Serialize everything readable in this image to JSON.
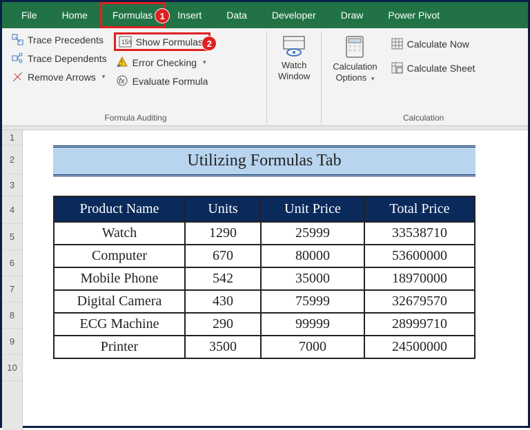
{
  "tabs": {
    "file": "File",
    "home": "Home",
    "formulas": "Formulas",
    "insert": "Insert",
    "data": "Data",
    "developer": "Developer",
    "draw": "Draw",
    "powerpivot": "Power Pivot"
  },
  "callouts": {
    "one": "1",
    "two": "2"
  },
  "ribbon": {
    "trace_precedents": "Trace Precedents",
    "trace_dependents": "Trace Dependents",
    "remove_arrows": "Remove Arrows",
    "show_formulas": "Show Formulas",
    "error_checking": "Error Checking",
    "evaluate_formula": "Evaluate Formula",
    "watch_window": "Watch Window",
    "calculation_options": "Calculation Options",
    "calculate_now": "Calculate Now",
    "calculate_sheet": "Calculate Sheet",
    "group_auditing": "Formula Auditing",
    "group_calculation": "Calculation"
  },
  "rows": {
    "r1": "1",
    "r2": "2",
    "r3": "3",
    "r4": "4",
    "r5": "5",
    "r6": "6",
    "r7": "7",
    "r8": "8",
    "r9": "9",
    "r10": "10"
  },
  "title": "Utilizing Formulas Tab",
  "table": {
    "headers": {
      "product": "Product Name",
      "units": "Units",
      "unitprice": "Unit Price",
      "total": "Total Price"
    },
    "rows": [
      {
        "product": "Watch",
        "units": "1290",
        "unitprice": "25999",
        "total": "33538710"
      },
      {
        "product": "Computer",
        "units": "670",
        "unitprice": "80000",
        "total": "53600000"
      },
      {
        "product": "Mobile Phone",
        "units": "542",
        "unitprice": "35000",
        "total": "18970000"
      },
      {
        "product": "Digital Camera",
        "units": "430",
        "unitprice": "75999",
        "total": "32679570"
      },
      {
        "product": "ECG Machine",
        "units": "290",
        "unitprice": "99999",
        "total": "28999710"
      },
      {
        "product": "Printer",
        "units": "3500",
        "unitprice": "7000",
        "total": "24500000"
      }
    ]
  }
}
